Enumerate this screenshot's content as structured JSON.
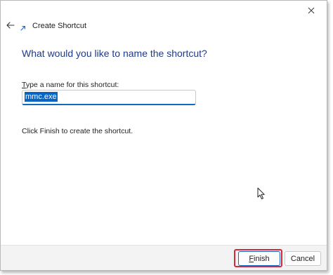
{
  "window": {
    "title": "Create Shortcut",
    "close_icon": "close-icon",
    "back_icon": "back-arrow-icon",
    "wizard_icon": "shortcut-icon"
  },
  "main": {
    "heading": "What would you like to name the shortcut?",
    "field_label_hotkey": "T",
    "field_label_rest": "ype a name for this shortcut:",
    "name_value": "mmc.exe",
    "info_text": "Click Finish to create the shortcut."
  },
  "footer": {
    "finish_hotkey": "F",
    "finish_rest": "inish",
    "cancel_label": "Cancel"
  },
  "colors": {
    "heading": "#1e3a8a",
    "accent": "#0f6cbd",
    "selection": "#0a64c2",
    "highlight": "#d6273b"
  }
}
